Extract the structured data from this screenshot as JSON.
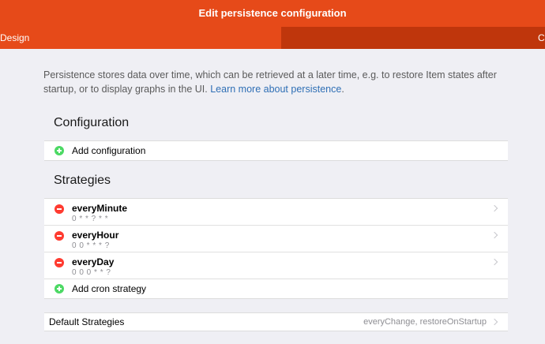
{
  "header": {
    "title": "Edit persistence configuration"
  },
  "tabs": [
    {
      "label": "Design"
    },
    {
      "label": "Co"
    }
  ],
  "intro": {
    "text": "Persistence stores data over time, which can be retrieved at a later time, e.g. to restore Item states after startup, or to display graphs in the UI.",
    "link": "Learn more about persistence",
    "suffix": "."
  },
  "configuration": {
    "title": "Configuration",
    "add_label": "Add configuration"
  },
  "strategies": {
    "title": "Strategies",
    "items": [
      {
        "name": "everyMinute",
        "cron": "0 * * ? * *"
      },
      {
        "name": "everyHour",
        "cron": "0 0 * * * ?"
      },
      {
        "name": "everyDay",
        "cron": "0 0 0 * * ?"
      }
    ],
    "add_label": "Add cron strategy"
  },
  "defaults": {
    "label": "Default Strategies",
    "value": "everyChange, restoreOnStartup"
  },
  "colors": {
    "header": "#e64a19",
    "tab_inactive": "#bf360c",
    "add": "#4cd964",
    "remove": "#ff3b30",
    "link": "#2f6fb5"
  }
}
